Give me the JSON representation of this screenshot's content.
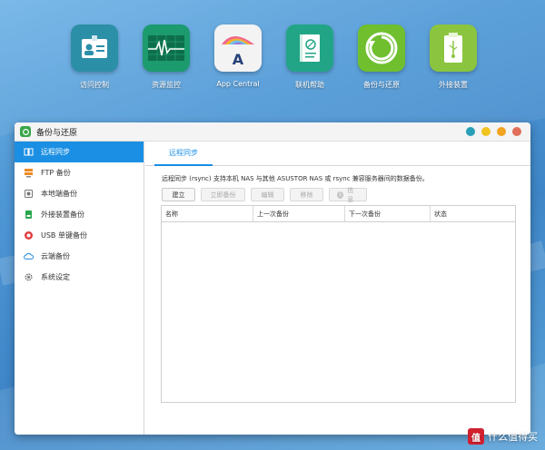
{
  "desktop": {
    "apps": [
      {
        "label": "访问控制",
        "icon": "id-card-icon"
      },
      {
        "label": "资源监控",
        "icon": "heartbeat-monitor-icon"
      },
      {
        "label": "App Central",
        "icon": "app-central-icon"
      },
      {
        "label": "联机帮助",
        "icon": "help-book-icon"
      },
      {
        "label": "备份与还原",
        "icon": "backup-restore-icon"
      },
      {
        "label": "外接装置",
        "icon": "usb-drive-icon"
      }
    ]
  },
  "window": {
    "title": "备份与还原",
    "controls": {
      "colors": [
        "#27a0b8",
        "#f2c41f",
        "#f2a31f",
        "#e0705a"
      ]
    }
  },
  "sidebar": {
    "items": [
      {
        "label": "远程同步",
        "icon": "remote-sync-icon",
        "active": true
      },
      {
        "label": "FTP 备份",
        "icon": "ftp-server-icon",
        "active": false
      },
      {
        "label": "本地端备份",
        "icon": "local-disk-icon",
        "active": false
      },
      {
        "label": "外接装置备份",
        "icon": "external-device-icon",
        "active": false
      },
      {
        "label": "USB 单键备份",
        "icon": "usb-one-touch-icon",
        "active": false
      },
      {
        "label": "云端备份",
        "icon": "cloud-icon",
        "active": false
      },
      {
        "label": "系统设定",
        "icon": "gear-icon",
        "active": false
      }
    ]
  },
  "main": {
    "tab": "远程同步",
    "description": "远程同步 (rsync) 支持本机 NAS 与其他 ASUSTOR NAS 或 rsync 兼容服务器间的数据备份。",
    "toolbar": {
      "create": "建立",
      "backup_now": "立即备份",
      "edit": "编辑",
      "remove": "移除",
      "info": "信息"
    },
    "table": {
      "columns": [
        "名称",
        "上一次备份",
        "下一次备份",
        "状态"
      ],
      "rows": []
    }
  },
  "watermark": {
    "badge": "值",
    "text": "什么值得买"
  },
  "colors": {
    "accent": "#1a8fe3",
    "background": "#4f98d6"
  }
}
